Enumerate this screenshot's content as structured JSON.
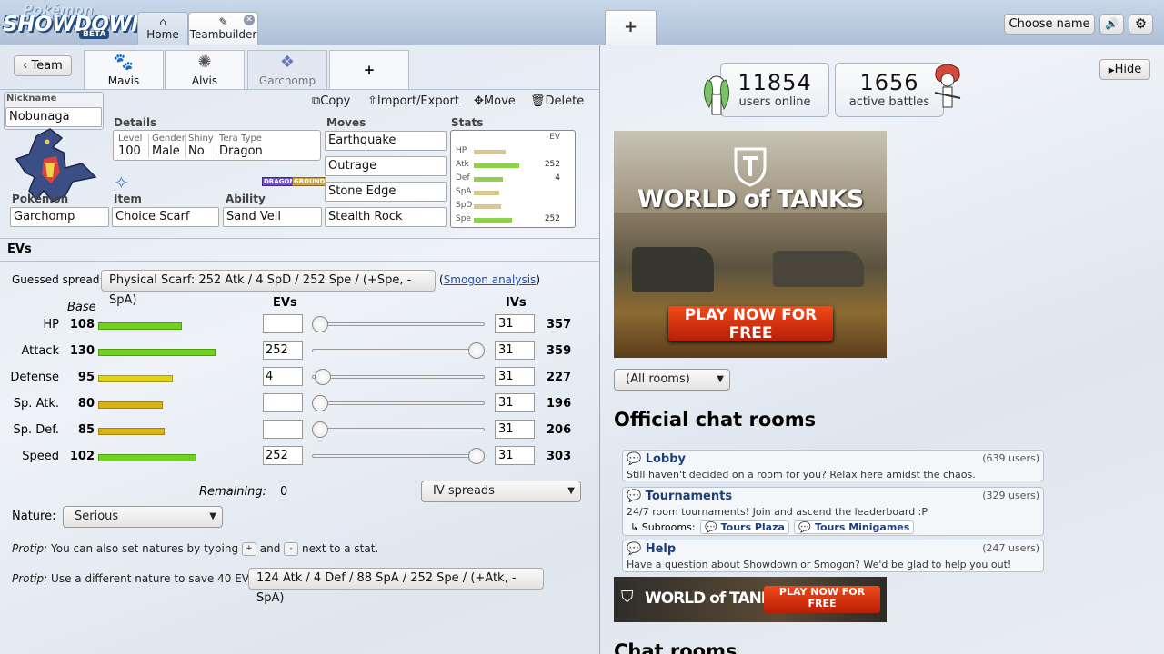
{
  "header": {
    "logo_top": "Pokémon",
    "logo_main": "SHOWDOWN",
    "logo_badge": "BETA",
    "tabs": [
      {
        "icon": "⌂",
        "label": "Home"
      },
      {
        "icon": "✎",
        "label": "Teambuilder"
      }
    ],
    "close_glyph": "✕",
    "new_tab": "+",
    "choose_name": "Choose name",
    "sound_icon": "🔊",
    "settings_icon": "⚙"
  },
  "teambuilder": {
    "team_button": "‹ Team",
    "pokemon_tabs": [
      "Mavis",
      "Alvis",
      "Garchomp"
    ],
    "add_tab": "+",
    "actions": {
      "copy": "Copy",
      "import_export": "Import/Export",
      "move": "Move",
      "delete": "Delete"
    },
    "nickname_label": "Nickname",
    "nickname": "Nobunaga",
    "details_label": "Details",
    "details": {
      "level_label": "Level",
      "level": "100",
      "gender_label": "Gender",
      "gender": "Male",
      "shiny_label": "Shiny",
      "shiny": "No",
      "tera_label": "Tera Type",
      "tera": "Dragon"
    },
    "types": [
      "DRAGON",
      "GROUND"
    ],
    "pokemon_label": "Pokémon",
    "pokemon": "Garchomp",
    "item_label": "Item",
    "item": "Choice Scarf",
    "ability_label": "Ability",
    "ability": "Sand Veil",
    "moves_label": "Moves",
    "moves": [
      "Earthquake",
      "Outrage",
      "Stone Edge",
      "Stealth Rock"
    ],
    "stats_label": "Stats",
    "stats_ev_label": "EV",
    "mini_stats": [
      {
        "name": "HP",
        "ev": "",
        "fill": 0.35
      },
      {
        "name": "Atk",
        "ev": "252",
        "fill": 0.5
      },
      {
        "name": "Def",
        "ev": "4",
        "fill": 0.32
      },
      {
        "name": "SpA",
        "ev": "",
        "fill": 0.28
      },
      {
        "name": "SpD",
        "ev": "",
        "fill": 0.3
      },
      {
        "name": "Spe",
        "ev": "252",
        "fill": 0.42
      }
    ]
  },
  "evs": {
    "header": "EVs",
    "guessed_label": "Guessed spread:",
    "guessed_value": "Physical Scarf: 252 Atk / 4 SpD / 252 Spe / (+Spe, -SpA)",
    "paren_open": "(",
    "smogon_link": "Smogon analysis",
    "paren_close": ")",
    "col_base": "Base",
    "col_evs": "EVs",
    "col_ivs": "IVs",
    "rows": [
      {
        "name": "HP",
        "base": "108",
        "ev": "",
        "iv": "31",
        "total": "357",
        "bar_fill": 0.43,
        "color": "#6fd21c",
        "slider": 0
      },
      {
        "name": "Attack",
        "base": "130",
        "ev": "252",
        "iv": "31",
        "total": "359",
        "bar_fill": 0.6,
        "color": "#6fd21c",
        "slider": 1
      },
      {
        "name": "Defense",
        "base": "95",
        "ev": "4",
        "iv": "31",
        "total": "227",
        "bar_fill": 0.38,
        "color": "#e0d218",
        "slider": 0.016
      },
      {
        "name": "Sp. Atk.",
        "base": "80",
        "ev": "",
        "iv": "31",
        "total": "196",
        "bar_fill": 0.33,
        "color": "#d9b316",
        "slider": 0
      },
      {
        "name": "Sp. Def.",
        "base": "85",
        "ev": "",
        "iv": "31",
        "total": "206",
        "bar_fill": 0.34,
        "color": "#d9b316",
        "slider": 0
      },
      {
        "name": "Speed",
        "base": "102",
        "ev": "252",
        "iv": "31",
        "total": "303",
        "bar_fill": 0.5,
        "color": "#6fd21c",
        "slider": 1
      }
    ],
    "remaining_label": "Remaining:",
    "remaining": "0",
    "iv_spreads": "IV spreads",
    "nature_label": "Nature:",
    "nature": "Serious",
    "protip_label": "Protip:",
    "protip1_a": "You can also set natures by typing",
    "protip1_plus": "+",
    "protip1_and": "and",
    "protip1_minus": "-",
    "protip1_b": "next to a stat.",
    "protip2_text": "Use a different nature to save 40 EVs:",
    "protip2_value": "124 Atk / 4 Def / 88 SpA / 252 Spe / (+Atk, -SpA)"
  },
  "right": {
    "hide": "Hide",
    "users_online_n": "11854",
    "users_online_t": "users online",
    "battles_n": "1656",
    "battles_t": "active battles",
    "ad_logo": "WORLD of TANKS",
    "ad_cta": "PLAY NOW FOR FREE",
    "room_filter": "(All rooms)",
    "official_title": "Official chat rooms",
    "rooms": [
      {
        "name": "Lobby",
        "users": "(639 users)",
        "desc": "Still haven't decided on a room for you? Relax here amidst the chaos."
      },
      {
        "name": "Tournaments",
        "users": "(329 users)",
        "desc": "24/7 room tournaments! Join and ascend the leaderboard :P"
      },
      {
        "name": "Help",
        "users": "(247 users)",
        "desc": "Have a question about Showdown or Smogon? We'd be glad to help you out!"
      }
    ],
    "subrooms_label": "↳ Subrooms:",
    "subrooms": [
      "Tours Plaza",
      "Tours Minigames"
    ],
    "chat_rooms_title": "Chat rooms"
  }
}
